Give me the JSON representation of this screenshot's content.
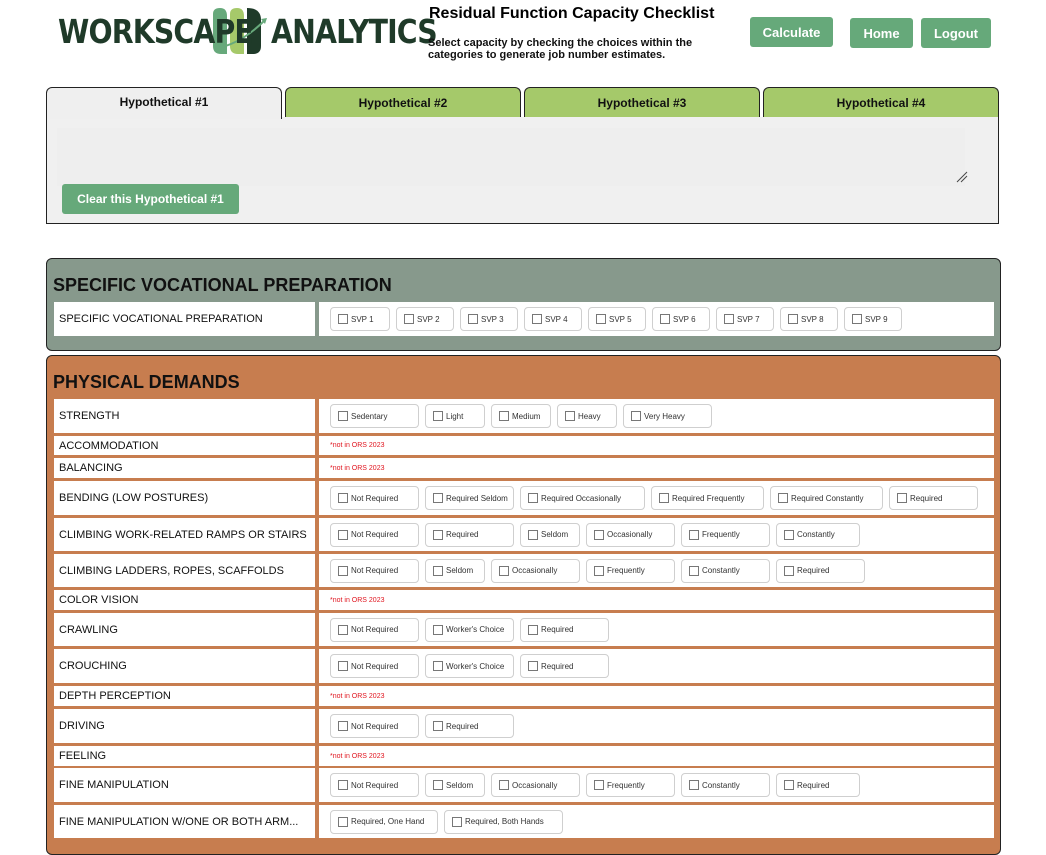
{
  "header": {
    "logo_left": "WORKSCAPE",
    "logo_right": "ANALYTICS",
    "logo_mark_icon": "workscape-leaf-mark-icon",
    "title": "Residual Function Capacity Checklist",
    "subtitle": "Select capacity by checking the choices within the categories to generate job number estimates.",
    "buttons": {
      "calculate": "Calculate",
      "home": "Home",
      "logout": "Logout"
    }
  },
  "tabs": [
    {
      "label": "Hypothetical #1",
      "active": true
    },
    {
      "label": "Hypothetical #2",
      "active": false
    },
    {
      "label": "Hypothetical #3",
      "active": false
    },
    {
      "label": "Hypothetical #4",
      "active": false
    }
  ],
  "tab_panel": {
    "notes_value": "",
    "clear_button": "Clear this Hypothetical #1"
  },
  "colors": {
    "brand_green": "#66a97a",
    "tab_inactive": "#a5c96a",
    "svp_section": "#87998c",
    "physical_section": "#c77d4f",
    "not_in_ors": "#e0141e"
  },
  "sections": {
    "svp": {
      "title": "SPECIFIC VOCATIONAL PREPARATION",
      "rows": [
        {
          "label": "SPECIFIC VOCATIONAL PREPARATION",
          "options": [
            "SVP 1",
            "SVP 2",
            "SVP 3",
            "SVP 4",
            "SVP 5",
            "SVP 6",
            "SVP 7",
            "SVP 8",
            "SVP 9"
          ]
        }
      ]
    },
    "physical": {
      "title": "PHYSICAL DEMANDS",
      "rows": [
        {
          "label": "STRENGTH",
          "options": [
            "Sedentary",
            "Light",
            "Medium",
            "Heavy",
            "Very Heavy"
          ]
        },
        {
          "label": "ACCOMMODATION",
          "note": "*not in ORS 2023"
        },
        {
          "label": "BALANCING",
          "note": "*not in ORS 2023"
        },
        {
          "label": "BENDING (LOW POSTURES)",
          "options": [
            "Not Required",
            "Required Seldom",
            "Required Occasionally",
            "Required Frequently",
            "Required Constantly",
            "Required"
          ]
        },
        {
          "label": "CLIMBING WORK-RELATED RAMPS OR STAIRS",
          "options": [
            "Not Required",
            "Required",
            "Seldom",
            "Occasionally",
            "Frequently",
            "Constantly"
          ]
        },
        {
          "label": "CLIMBING LADDERS, ROPES, SCAFFOLDS",
          "options": [
            "Not Required",
            "Seldom",
            "Occasionally",
            "Frequently",
            "Constantly",
            "Required"
          ]
        },
        {
          "label": "COLOR VISION",
          "note": "*not in ORS 2023"
        },
        {
          "label": "CRAWLING",
          "options": [
            "Not Required",
            "Worker's Choice",
            "Required"
          ]
        },
        {
          "label": "CROUCHING",
          "options": [
            "Not Required",
            "Worker's Choice",
            "Required"
          ]
        },
        {
          "label": "DEPTH PERCEPTION",
          "note": "*not in ORS 2023"
        },
        {
          "label": "DRIVING",
          "options": [
            "Not Required",
            "Required"
          ]
        },
        {
          "label": "FEELING",
          "note": "*not in ORS 2023"
        },
        {
          "label": "FINE MANIPULATION",
          "options": [
            "Not Required",
            "Seldom",
            "Occasionally",
            "Frequently",
            "Constantly",
            "Required"
          ]
        },
        {
          "label": "FINE MANIPULATION W/ONE OR BOTH ARM...",
          "options": [
            "Required, One Hand",
            "Required, Both Hands"
          ]
        }
      ]
    }
  }
}
